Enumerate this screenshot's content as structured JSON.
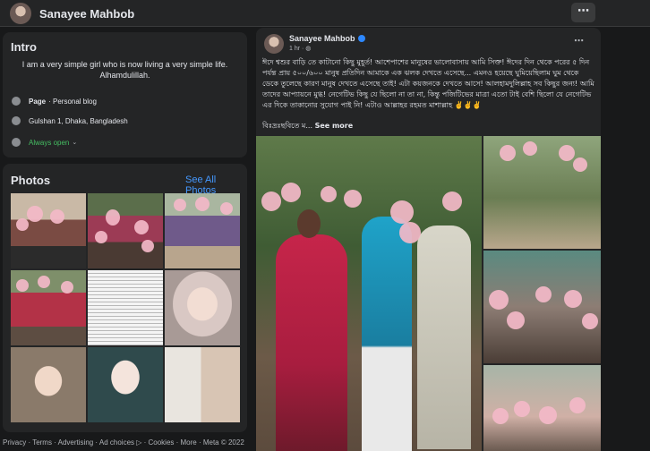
{
  "profile": {
    "name": "Sanayee Mahbob",
    "more_icon": "⋯"
  },
  "intro": {
    "title": "Intro",
    "bio": "I am a very simple girl who is now living a very simple life. Alhamdulillah.",
    "page_label": "Page",
    "page_category": "· Personal blog",
    "location": "Gulshan 1, Dhaka, Bangladesh",
    "hours": "Always open"
  },
  "photos": {
    "title": "Photos",
    "see_all": "See All Photos"
  },
  "footer": "Privacy · Terms · Advertising · Ad choices ▷ · Cookies · More · Meta © 2022",
  "post": {
    "author": "Sanayee Mahbob",
    "time": "1 hr ·",
    "more_icon": "⋯",
    "text": "ঈদে শ্বশুর বাড়ি তে কাটানো কিছু মুহূর্ত! আশেপাশের মানুষের ভালোবাসায় আমি সিক্ত! ঈদের দিন থেকে পরের ৫ দিন পর্যন্ত প্রায় ৫০০/৬০০ মানুষ প্রতিদিন আমাকে এক ঝলক দেখতে এসেছে... এমনও হয়েছে ঘুমিয়েছিলাম ঘুম থেকে ডেকে তুলেছে কারণ মানুষ দেখতে এসেছে তাই! এটা কয়জনকে দেখতে আসে! আলহামদুলিল্লাহ সব কিছুর জন্য! আমি তাদের আপ্যায়নে মুগ্ধ! নেগেটিভ কিছু যে ছিলো না তা না, কিন্তু পজিটিভের মাত্রা এতো টাই বেশি ছিলো যে নেগেটিভ এর দিকে তাকানোর সুযোগ পাই নি! এটাও আল্লাহর রহমত মাশাল্লাহ ✌️✌️✌️",
    "tail": "বিঃদ্রঃছবিতে ম... ",
    "see_more": "See more"
  },
  "colors": {
    "background": "#18191a",
    "card": "#242526",
    "link": "#4599ff",
    "open": "#45bd62",
    "verified": "#2d88ff"
  },
  "icons": [
    "info-icon",
    "pin-icon",
    "clock-icon",
    "verified-badge-icon",
    "globe-icon"
  ]
}
